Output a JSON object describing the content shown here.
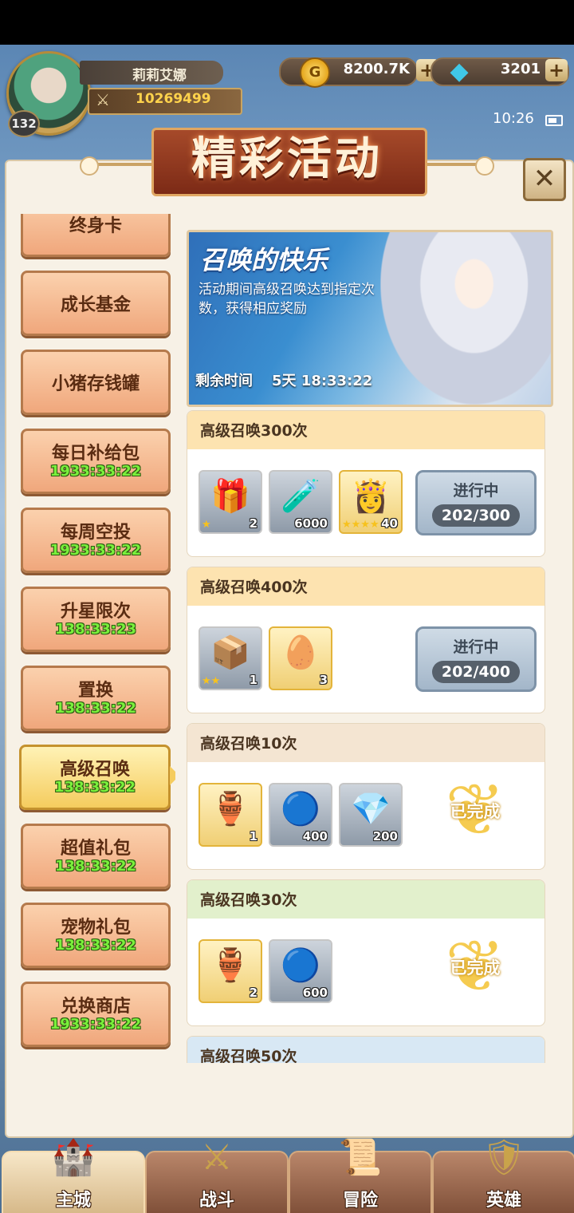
{
  "player": {
    "name": "莉莉艾娜",
    "level": "132",
    "power": "10269499"
  },
  "currency": {
    "gold": "8200.7K",
    "gems": "3201",
    "plus": "+"
  },
  "status": {
    "time": "10:26"
  },
  "title": "精彩活动",
  "close_label": "✕",
  "sidebar": {
    "items": [
      {
        "label": "终身卡",
        "timer": ""
      },
      {
        "label": "成长基金",
        "timer": ""
      },
      {
        "label": "小猪存钱罐",
        "timer": ""
      },
      {
        "label": "每日补给包",
        "timer": "1933:33:22"
      },
      {
        "label": "每周空投",
        "timer": "1933:33:22"
      },
      {
        "label": "升星限次",
        "timer": "138:33:23"
      },
      {
        "label": "置换",
        "timer": "138:33:22"
      },
      {
        "label": "高级召唤",
        "timer": "138:33:22"
      },
      {
        "label": "超值礼包",
        "timer": "138:33:22"
      },
      {
        "label": "宠物礼包",
        "timer": "138:33:22"
      },
      {
        "label": "兑换商店",
        "timer": "1933:33:22"
      }
    ],
    "active_index": 7
  },
  "banner": {
    "title": "召唤的快乐",
    "description": "活动期间高级召唤达到指定次数，获得相应奖励",
    "time_label": "剩余时间",
    "time_value": "5天 18:33:22"
  },
  "tasks": [
    {
      "title": "高级召唤300次",
      "header_color": "#fde3b0",
      "rewards": [
        {
          "icon": "treasure-chest-icon",
          "glyph": "🎁",
          "count": "2",
          "stars": "★"
        },
        {
          "icon": "potion-flask-icon",
          "glyph": "🧪",
          "count": "6000",
          "stars": ""
        },
        {
          "icon": "hero-portrait-icon",
          "glyph": "👸",
          "count": "40",
          "stars": "★★★★★"
        }
      ],
      "status": "进行中",
      "progress": "202/300"
    },
    {
      "title": "高级召唤400次",
      "header_color": "#fde3b0",
      "rewards": [
        {
          "icon": "silver-chest-icon",
          "glyph": "📦",
          "count": "1",
          "stars": "★★"
        },
        {
          "icon": "golden-egg-icon",
          "glyph": "🥚",
          "count": "3",
          "stars": ""
        }
      ],
      "status": "进行中",
      "progress": "202/400"
    },
    {
      "title": "高级召唤10次",
      "header_color": "#f4e5d2",
      "rewards": [
        {
          "icon": "blue-vase-icon",
          "glyph": "🏺",
          "count": "1",
          "stars": ""
        },
        {
          "icon": "blue-orb-icon",
          "glyph": "🔵",
          "count": "400",
          "stars": ""
        },
        {
          "icon": "diamond-icon",
          "glyph": "💎",
          "count": "200",
          "stars": ""
        }
      ],
      "status": "已完成",
      "progress": ""
    },
    {
      "title": "高级召唤30次",
      "header_color": "#e2f0cc",
      "rewards": [
        {
          "icon": "blue-vase-icon",
          "glyph": "🏺",
          "count": "2",
          "stars": ""
        },
        {
          "icon": "blue-orb-icon",
          "glyph": "🔵",
          "count": "600",
          "stars": ""
        }
      ],
      "status": "已完成",
      "progress": ""
    },
    {
      "title": "高级召唤50次",
      "header_color": "#d8e8f4",
      "rewards": [],
      "status": "",
      "progress": ""
    }
  ],
  "nav": [
    {
      "label": "主城",
      "icon": "castle-icon",
      "active": true
    },
    {
      "label": "战斗",
      "icon": "crossed-swords-icon",
      "active": false
    },
    {
      "label": "冒险",
      "icon": "map-scroll-icon",
      "active": false
    },
    {
      "label": "英雄",
      "icon": "hero-crest-icon",
      "active": false
    }
  ],
  "colors": {
    "accent": "#f0a77c",
    "timer": "#7af03c",
    "panel": "#f7f1e6"
  }
}
